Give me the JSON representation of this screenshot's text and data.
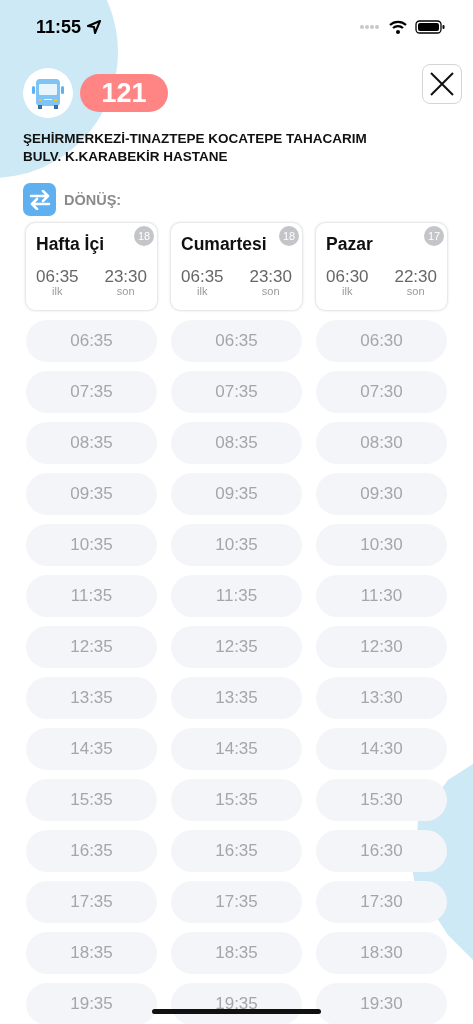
{
  "status_bar": {
    "time": "11:55"
  },
  "route": {
    "number": "121",
    "name": "ŞEHİRMERKEZİ-TINAZTEPE KOCATEPE TAHACARIM BULV. K.KARABEKİR HASTANE"
  },
  "direction": {
    "label": "DÖNÜŞ:"
  },
  "schedules": [
    {
      "day": "Hafta İçi",
      "count": "18",
      "first": "06:35",
      "first_label": "ilk",
      "last": "23:30",
      "last_label": "son",
      "times": [
        "06:35",
        "07:35",
        "08:35",
        "09:35",
        "10:35",
        "11:35",
        "12:35",
        "13:35",
        "14:35",
        "15:35",
        "16:35",
        "17:35",
        "18:35",
        "19:35"
      ]
    },
    {
      "day": "Cumartesi",
      "count": "18",
      "first": "06:35",
      "first_label": "ilk",
      "last": "23:30",
      "last_label": "son",
      "times": [
        "06:35",
        "07:35",
        "08:35",
        "09:35",
        "10:35",
        "11:35",
        "12:35",
        "13:35",
        "14:35",
        "15:35",
        "16:35",
        "17:35",
        "18:35",
        "19:35"
      ]
    },
    {
      "day": "Pazar",
      "count": "17",
      "first": "06:30",
      "first_label": "ilk",
      "last": "22:30",
      "last_label": "son",
      "times": [
        "06:30",
        "07:30",
        "08:30",
        "09:30",
        "10:30",
        "11:30",
        "12:30",
        "13:30",
        "14:30",
        "15:30",
        "16:30",
        "17:30",
        "18:30",
        "19:30"
      ]
    }
  ]
}
